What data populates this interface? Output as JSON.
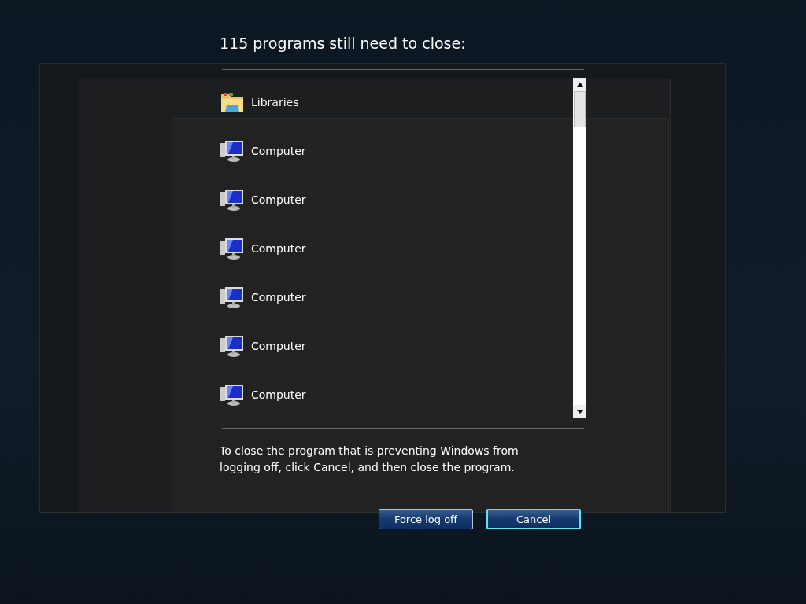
{
  "title": "115 programs still need to close:",
  "programs": [
    {
      "kind": "libraries",
      "name": "Libraries"
    },
    {
      "kind": "computer",
      "name": "Computer"
    },
    {
      "kind": "computer",
      "name": "Computer"
    },
    {
      "kind": "computer",
      "name": "Computer"
    },
    {
      "kind": "computer",
      "name": "Computer"
    },
    {
      "kind": "computer",
      "name": "Computer"
    },
    {
      "kind": "computer",
      "name": "Computer"
    }
  ],
  "message": "To close the program that is preventing Windows from logging off, click Cancel, and then close the program.",
  "buttons": [
    {
      "label": "Force log off",
      "focused": false
    },
    {
      "label": "Cancel",
      "focused": true
    }
  ]
}
